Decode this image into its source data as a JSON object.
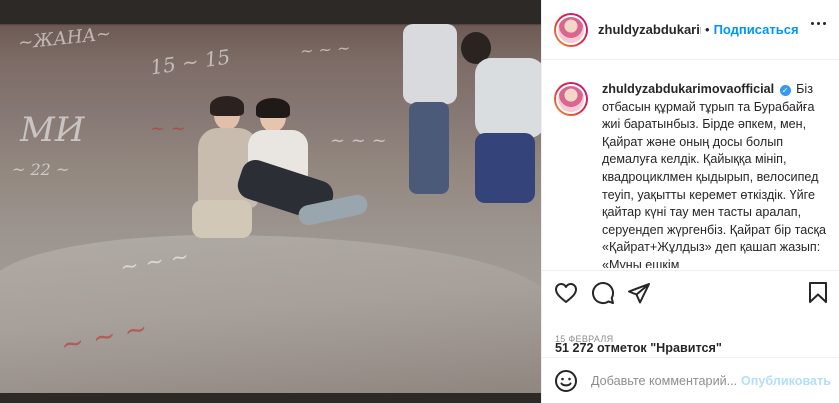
{
  "post": {
    "username": "zhuldyzabdukarimovaofficial",
    "header_username": "zhuldyzabdukarimov",
    "separator": "•",
    "follow_label": "Подписаться",
    "caption": "Біз отбасын құрмай тұрып та Бурабайға жиі баратынбыз. Бірде әпкем, мен, Қайрат және оның досы болып демалуға келдік. Қайыққа мініп, квадроциклмен қыдырып, велосипед теуіп, уақытты керемет өткіздік. Үйге қайтар күні тау мен тасты аралап, серуендеп жүргенбіз. Қайрат бір тасқа «Қайрат+Жұлдыз» деп қашап жазып: «Мұны ешкім",
    "likes_text": "51 272 отметок \"Нравится\"",
    "date": "15 февраля"
  },
  "comment": {
    "placeholder": "Добавьте комментарий...",
    "post_label": "Опубликовать"
  },
  "icons": {
    "like": "heart-icon",
    "comment": "comment-icon",
    "share": "paper-plane-icon",
    "save": "bookmark-icon",
    "emoji": "smiley-icon",
    "more": "more-dots-icon",
    "verified": "verified-badge-icon"
  },
  "colors": {
    "accent_blue": "#0095f6",
    "verified_blue": "#3897f0",
    "border": "#efefef",
    "muted_text": "#8e8e8e",
    "post_disabled": "#b2dffc"
  }
}
